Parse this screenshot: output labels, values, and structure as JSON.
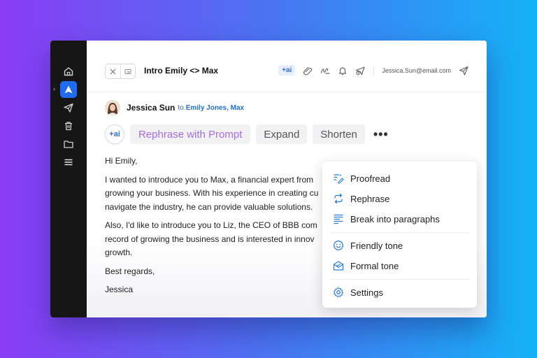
{
  "colors": {
    "accent": "#1f6bf2",
    "link": "#1e6fd6",
    "rephrase": "#a66ce6"
  },
  "sidebar": {
    "items": [
      {
        "icon": "home-icon"
      },
      {
        "icon": "compose-icon"
      },
      {
        "icon": "send-icon"
      },
      {
        "icon": "trash-icon"
      },
      {
        "icon": "folder-icon"
      },
      {
        "icon": "menu-icon"
      }
    ]
  },
  "header": {
    "subject": "Intro Emily <> Max",
    "ai_chip": "+ai",
    "email": "Jessica.Sun@email.com"
  },
  "from": {
    "name": "Jessica Sun",
    "to_prefix": "to",
    "to_names": "Emily Jones, Max"
  },
  "ai_bar": {
    "ai_label": "+ai",
    "rephrase_prompt": "Rephrase with Prompt",
    "expand": "Expand",
    "shorten": "Shorten",
    "more": "•••"
  },
  "body": {
    "greeting": "Hi Emily,",
    "p1_l1": "I wanted to introduce you to Max, a financial expert from",
    "p1_l2": "growing your business. With his experience in creating cu",
    "p1_l3": "navigate the industry, he can provide valuable solutions.",
    "p2_l1": "Also, I'd like to introduce you to Liz, the CEO of BBB com",
    "p2_l2": "record of growing the business and is interested in innov",
    "p2_l3": "growth.",
    "closing": "Best regards,",
    "signature": "Jessica"
  },
  "menu": {
    "proofread": "Proofread",
    "rephrase": "Rephrase",
    "paragraphs": "Break into paragraphs",
    "friendly": "Friendly tone",
    "formal": "Formal tone",
    "settings": "Settings"
  }
}
